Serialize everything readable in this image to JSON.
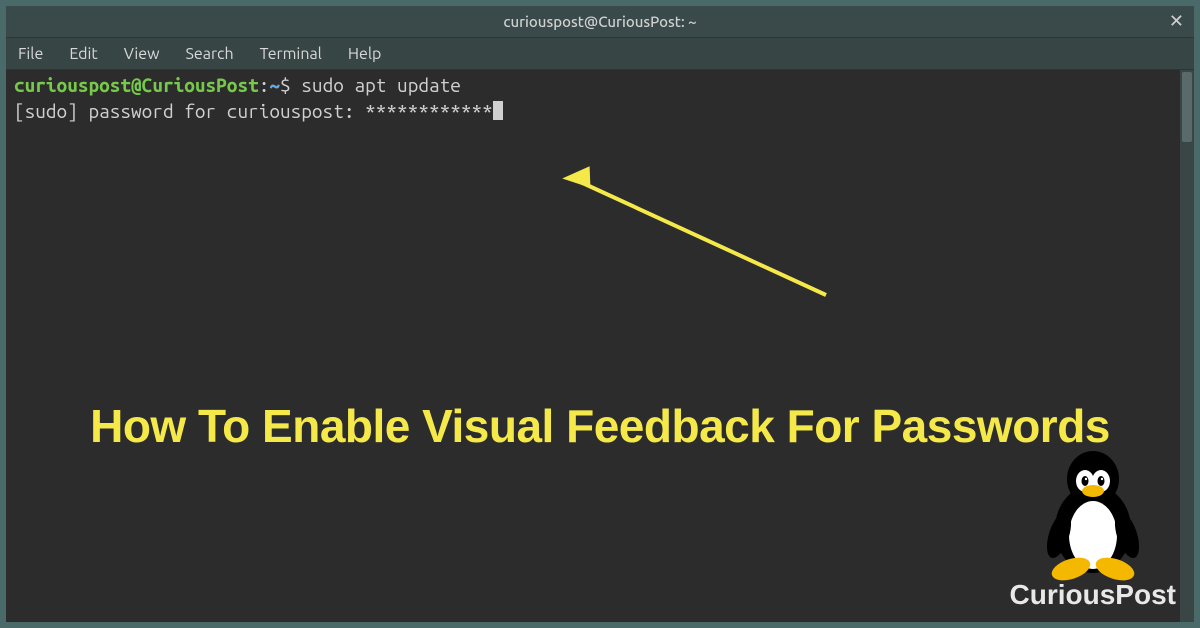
{
  "window": {
    "title": "curiouspost@CuriousPost: ~"
  },
  "menu": {
    "items": [
      "File",
      "Edit",
      "View",
      "Search",
      "Terminal",
      "Help"
    ]
  },
  "terminal": {
    "user_host": "curiouspost@CuriousPost",
    "path": "~",
    "prompt_symbol": "$",
    "command": "sudo apt update",
    "sudo_line_prefix": "[sudo] password for curiouspost: ",
    "password_mask": "************"
  },
  "headline": "How To Enable Visual Feedback For Passwords",
  "brand": "CuriousPost"
}
